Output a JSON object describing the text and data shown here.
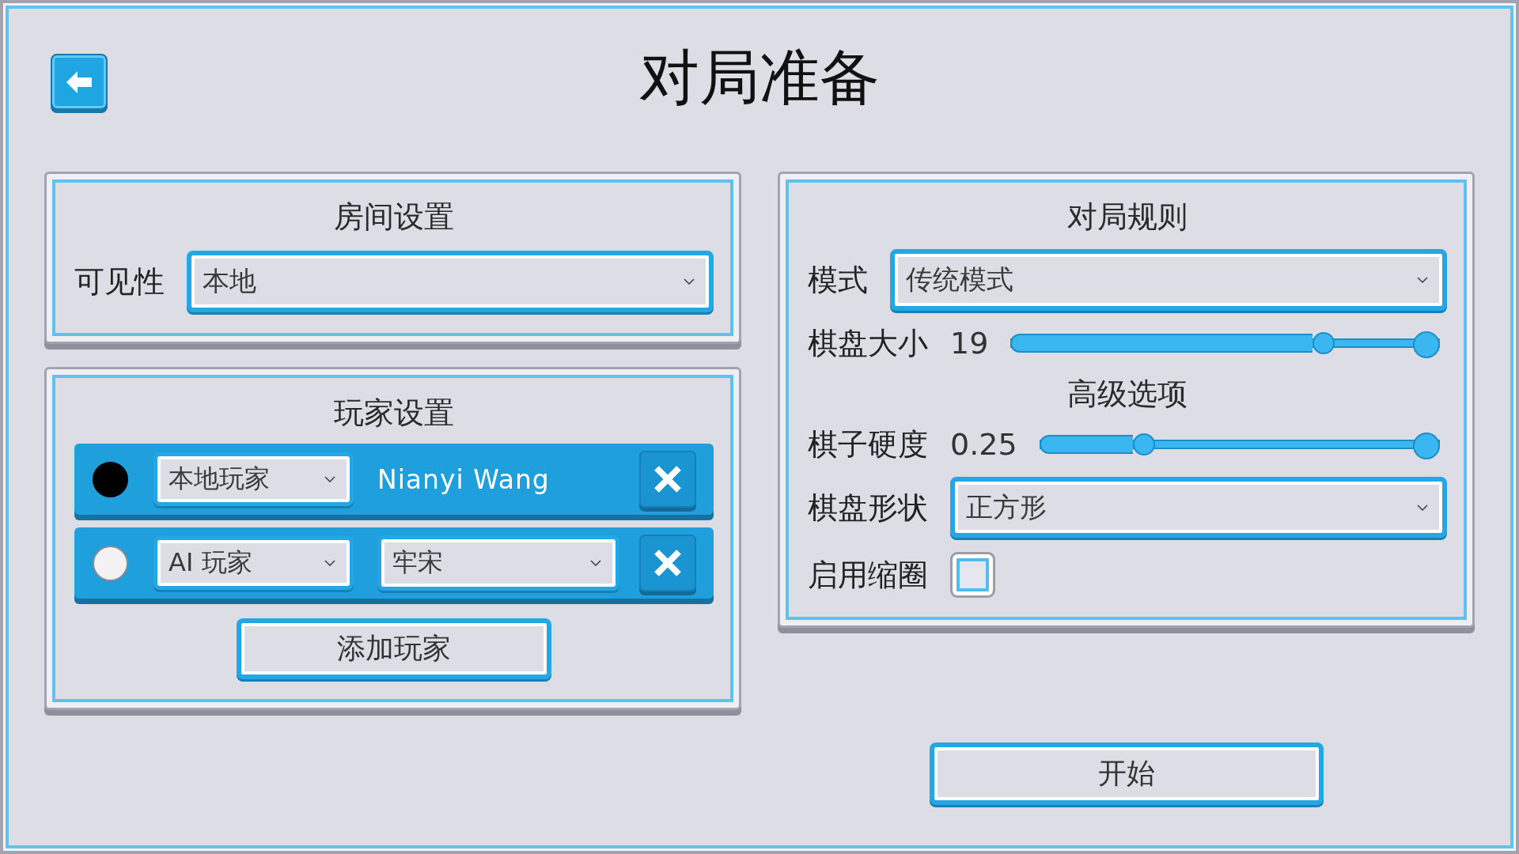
{
  "header": {
    "title": "对局准备"
  },
  "room_settings": {
    "title": "房间设置",
    "visibility": {
      "label": "可见性",
      "value": "本地"
    }
  },
  "player_settings": {
    "title": "玩家设置",
    "players": [
      {
        "kind": "local",
        "color": "#000000",
        "type": "本地玩家",
        "name": "Nianyi Wang"
      },
      {
        "kind": "ai",
        "color": "#f2f2f2",
        "type": "AI 玩家",
        "engine": "牢宋"
      }
    ],
    "add_button": "添加玩家"
  },
  "game_rules": {
    "title": "对局规则",
    "mode": {
      "label": "模式",
      "value": "传统模式"
    },
    "board_size": {
      "label": "棋盘大小",
      "reading": "19",
      "level": 0.75
    },
    "advanced_title": "高级选项",
    "stone_hardness": {
      "label": "棋子硬度",
      "reading": "0.25",
      "level": 0.27
    },
    "board_shape": {
      "label": "棋盘形状",
      "value": "正方形"
    },
    "shrinking_ring": {
      "label": "启用缩圈",
      "checked": false
    }
  },
  "start_button": "开始"
}
